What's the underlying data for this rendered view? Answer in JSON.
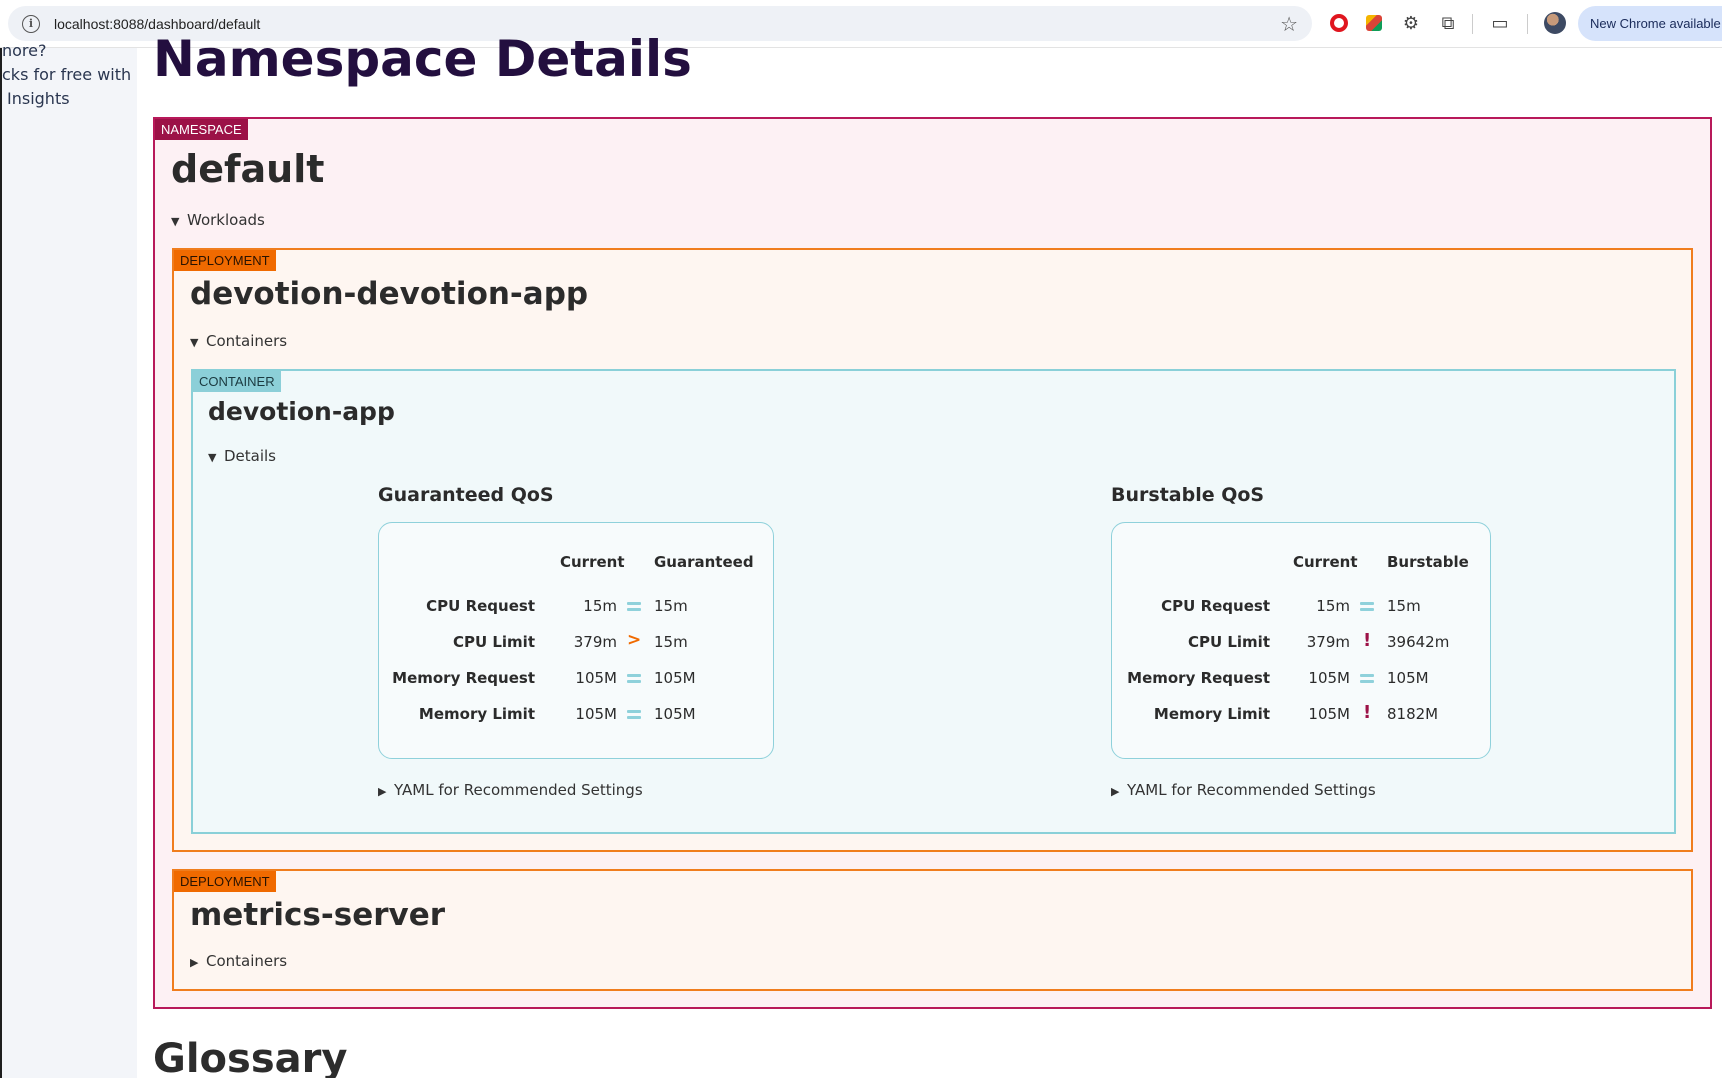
{
  "browser": {
    "url": "localhost:8088/dashboard/default",
    "update_label": "New Chrome available"
  },
  "sidebar": {
    "lines": [
      "nore?",
      "cks for free with",
      "Insights"
    ]
  },
  "page": {
    "title": "Namespace Details",
    "glossary_title": "Glossary"
  },
  "namespace": {
    "tag": "NAMESPACE",
    "name": "default",
    "toggle_label": "Workloads",
    "deployments": [
      {
        "tag": "DEPLOYMENT",
        "name": "devotion-devotion-app",
        "toggle_label": "Containers",
        "expanded": true,
        "container": {
          "tag": "CONTAINER",
          "name": "devotion-app",
          "toggle_label": "Details",
          "guaranteed": {
            "title": "Guaranteed QoS",
            "col_current": "Current",
            "col_target": "Guaranteed",
            "rows": [
              {
                "label": "CPU Request",
                "current": "15m",
                "cmp": "equal",
                "target": "15m"
              },
              {
                "label": "CPU Limit",
                "current": "379m",
                "cmp": "greater",
                "target": "15m"
              },
              {
                "label": "Memory Request",
                "current": "105M",
                "cmp": "equal",
                "target": "105M"
              },
              {
                "label": "Memory Limit",
                "current": "105M",
                "cmp": "equal",
                "target": "105M"
              }
            ],
            "yaml_label": "YAML for Recommended Settings"
          },
          "burstable": {
            "title": "Burstable QoS",
            "col_current": "Current",
            "col_target": "Burstable",
            "rows": [
              {
                "label": "CPU Request",
                "current": "15m",
                "cmp": "equal",
                "target": "15m"
              },
              {
                "label": "CPU Limit",
                "current": "379m",
                "cmp": "warning",
                "target": "39642m"
              },
              {
                "label": "Memory Request",
                "current": "105M",
                "cmp": "equal",
                "target": "105M"
              },
              {
                "label": "Memory Limit",
                "current": "105M",
                "cmp": "warning",
                "target": "8182M"
              }
            ],
            "yaml_label": "YAML for Recommended Settings"
          }
        }
      },
      {
        "tag": "DEPLOYMENT",
        "name": "metrics-server",
        "toggle_label": "Containers",
        "expanded": false
      }
    ]
  },
  "colors": {
    "namespace": "#9c1247",
    "deployment": "#f06a00",
    "container": "#8ccfd8"
  }
}
